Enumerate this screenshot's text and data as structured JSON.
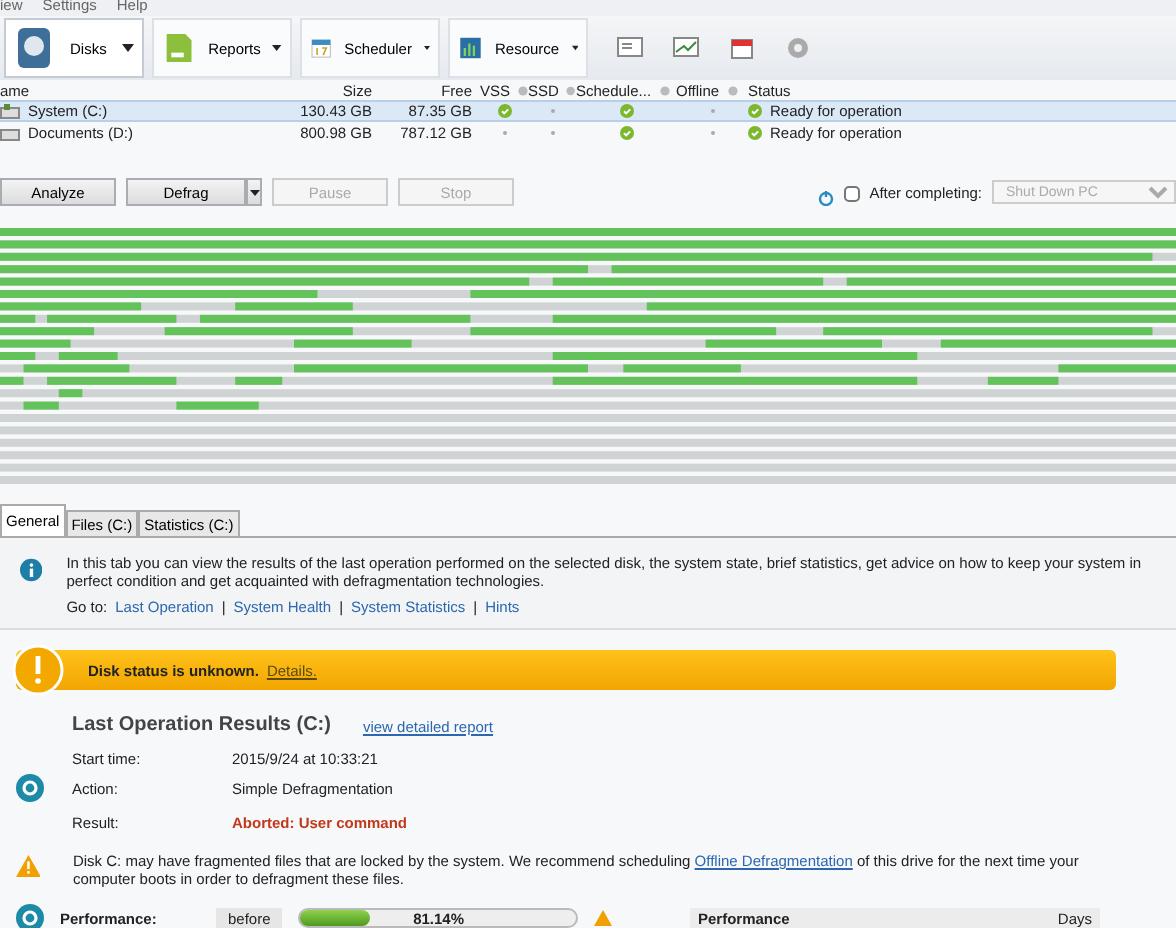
{
  "menu": [
    "iew",
    "Settings",
    "Help"
  ],
  "toolbar": [
    {
      "label": "Disks",
      "selected": true,
      "kind": "disk"
    },
    {
      "label": "Reports",
      "selected": false,
      "kind": "report"
    },
    {
      "label": "Scheduler",
      "selected": false,
      "kind": "calendar"
    },
    {
      "label": "Resource",
      "selected": false,
      "kind": "chart"
    }
  ],
  "disk_table": {
    "columns": [
      {
        "label": "ame",
        "info": false
      },
      {
        "label": "Size",
        "info": false
      },
      {
        "label": "Free",
        "info": false
      },
      {
        "label": "VSS",
        "info": true
      },
      {
        "label": "SSD",
        "info": true
      },
      {
        "label": "Schedule...",
        "info": true
      },
      {
        "label": "Offline",
        "info": true
      },
      {
        "label": "Status",
        "info": false
      }
    ],
    "rows": [
      {
        "name": "System (C:)",
        "size": "130.43 GB",
        "free": "87.35 GB",
        "vss": true,
        "ssd": false,
        "scheduled": true,
        "offline": false,
        "status": "Ready for operation",
        "selected": true
      },
      {
        "name": "Documents (D:)",
        "size": "800.98 GB",
        "free": "787.12 GB",
        "vss": false,
        "ssd": false,
        "scheduled": true,
        "offline": false,
        "status": "Ready for operation",
        "selected": false
      }
    ]
  },
  "actions": [
    {
      "label": "Analyze",
      "disabled": false,
      "dropdown": false
    },
    {
      "label": "Defrag",
      "disabled": false,
      "dropdown": true
    },
    {
      "label": "Pause",
      "disabled": true,
      "dropdown": false
    },
    {
      "label": "Stop",
      "disabled": true,
      "dropdown": false
    }
  ],
  "after_completing": {
    "label": "After completing:",
    "checked": false,
    "value": "Shut Down PC",
    "disabled": true
  },
  "tabs": [
    {
      "label": "General",
      "selected": true
    },
    {
      "label": "Files (C:)",
      "selected": false
    },
    {
      "label": "Statistics (C:)",
      "selected": false
    }
  ],
  "info": {
    "text": "In this tab you can view the results of the last operation performed on the selected disk, the system state, brief statistics, get advice on how to keep your system in perfect condition and get acquainted with defragmentation technologies.",
    "goto_label": "Go to:",
    "links": [
      "Last Operation",
      "System Health",
      "System Statistics",
      "Hints"
    ],
    "separator": "|"
  },
  "banner": {
    "text": "Disk status is unknown.",
    "link": "Details."
  },
  "results": {
    "title": "Last Operation Results (C:)",
    "link": "view detailed report",
    "fields": [
      {
        "label": "Start time:",
        "value": "2015/9/24 at 10:33:21",
        "kind": "normal"
      },
      {
        "label": "Action:",
        "value": "Simple Defragmentation",
        "kind": "normal"
      },
      {
        "label": "Result:",
        "value": "Aborted: User command",
        "kind": "error"
      }
    ]
  },
  "warning": {
    "before": "Disk C: may have fragmented files that are locked by the system. We recommend scheduling ",
    "link": "Offline Defragmentation",
    "after": " of this drive for the next time your computer boots in order to defragment these files."
  },
  "performance": {
    "label": "Performance:",
    "stage": "before",
    "level": 0.25,
    "reading": "81.14%",
    "panel_columns": [
      "Performance",
      "Days"
    ]
  }
}
